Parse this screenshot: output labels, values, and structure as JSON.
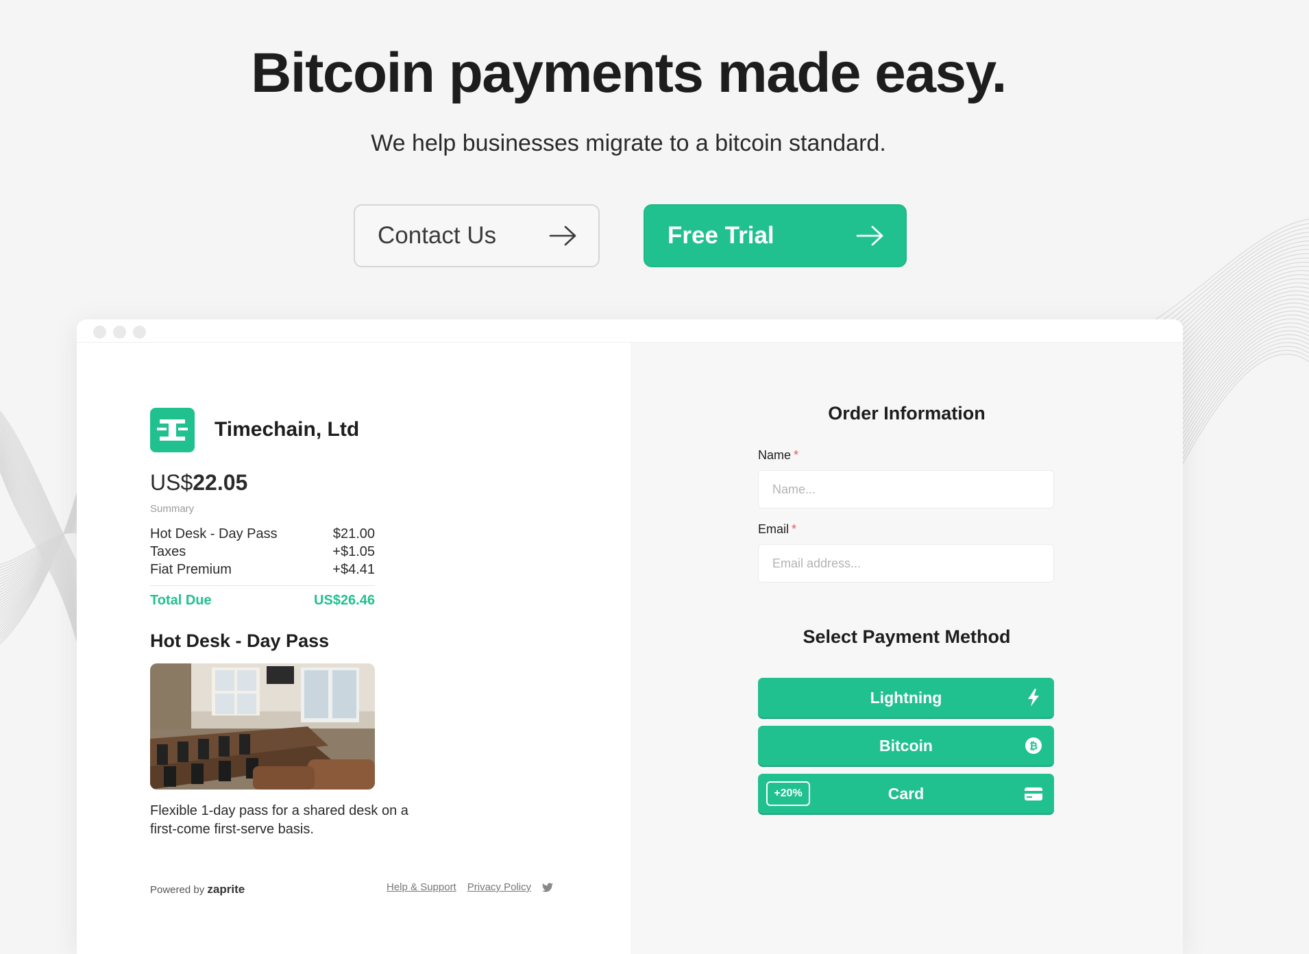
{
  "hero": {
    "title": "Bitcoin payments made easy.",
    "subtitle": "We help businesses migrate to a bitcoin standard.",
    "contact_label": "Contact Us",
    "trial_label": "Free Trial"
  },
  "colors": {
    "accent": "#21c08f",
    "background": "#f5f5f5"
  },
  "checkout": {
    "merchant_name": "Timechain, Ltd",
    "amount_currency": "US$",
    "amount_value": "22.05",
    "summary_label": "Summary",
    "items": [
      {
        "name": "Hot Desk - Day Pass",
        "amount": "$21.00"
      },
      {
        "name": "Taxes",
        "amount": "+$1.05"
      },
      {
        "name": "Fiat Premium",
        "amount": "+$4.41"
      }
    ],
    "total_label": "Total Due",
    "total_value": "US$26.46",
    "product_title": "Hot Desk - Day Pass",
    "product_description": "Flexible 1-day pass for a shared desk on a first-come first-serve basis.",
    "powered_by": "Powered by",
    "brand": "zaprite",
    "help_link": "Help & Support",
    "privacy_link": "Privacy Policy"
  },
  "order": {
    "title": "Order Information",
    "name_label": "Name",
    "name_placeholder": "Name...",
    "email_label": "Email",
    "email_placeholder": "Email address...",
    "required_mark": "*",
    "payment_title": "Select Payment Method",
    "methods": [
      {
        "label": "Lightning",
        "icon": "lightning-icon"
      },
      {
        "label": "Bitcoin",
        "icon": "bitcoin-icon"
      },
      {
        "label": "Card",
        "icon": "card-icon",
        "badge": "+20%"
      }
    ]
  }
}
